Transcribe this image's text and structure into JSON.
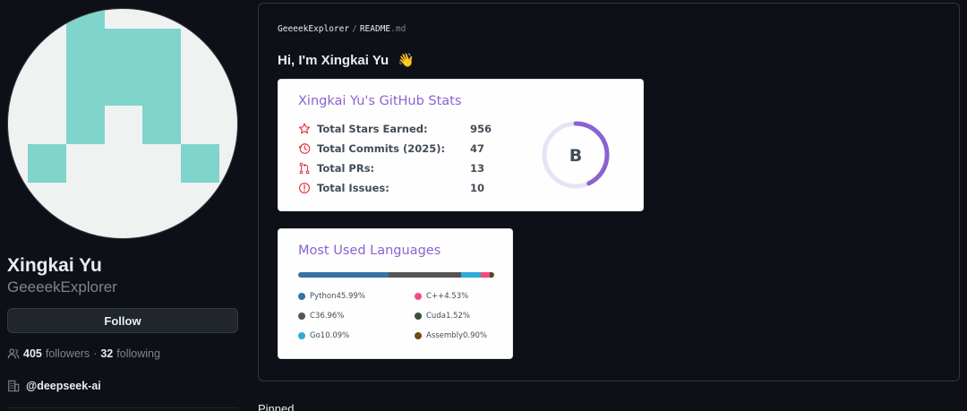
{
  "profile": {
    "full_name": "Xingkai Yu",
    "username": "GeeeekExplorer",
    "follow_label": "Follow",
    "followers_count": "405",
    "followers_label": "followers",
    "dot": "·",
    "following_count": "32",
    "following_label": "following",
    "organization": "@deepseek-ai"
  },
  "readme": {
    "crumb_user": "GeeeekExplorer",
    "crumb_sep": "/",
    "crumb_file": "README",
    "crumb_ext": ".md",
    "greeting": "Hi, I'm Xingkai Yu",
    "greeting_emoji": "👋"
  },
  "stats_card": {
    "title": "Xingkai Yu's GitHub Stats",
    "rows": [
      {
        "label": "Total Stars Earned:",
        "value": "956",
        "icon": "star-icon"
      },
      {
        "label": "Total Commits (2025):",
        "value": "47",
        "icon": "clock-icon"
      },
      {
        "label": "Total PRs:",
        "value": "13",
        "icon": "pull-request-icon"
      },
      {
        "label": "Total Issues:",
        "value": "10",
        "icon": "issue-icon"
      }
    ],
    "rank": "B",
    "rank_progress": 0.43
  },
  "lang_card": {
    "title": "Most Used Languages",
    "languages": [
      {
        "name": "Python",
        "percent": "45.99%",
        "value": 45.99,
        "color": "#3572a5"
      },
      {
        "name": "C",
        "percent": "36.96%",
        "value": 36.96,
        "color": "#555555"
      },
      {
        "name": "Go",
        "percent": "10.09%",
        "value": 10.09,
        "color": "#2fabd8"
      },
      {
        "name": "C++",
        "percent": "4.53%",
        "value": 4.53,
        "color": "#f34b7d"
      },
      {
        "name": "Cuda",
        "percent": "1.52%",
        "value": 1.52,
        "color": "#3a4e3a"
      },
      {
        "name": "Assembly",
        "percent": "0.90%",
        "value": 0.9,
        "color": "#6e4c13"
      }
    ]
  },
  "pinned_label": "Pinned",
  "colors": {
    "background": "#0d1117",
    "accent_title": "#8a63d2",
    "icon_red": "#e1363f",
    "avatar_teal": "#7fd4cc"
  }
}
